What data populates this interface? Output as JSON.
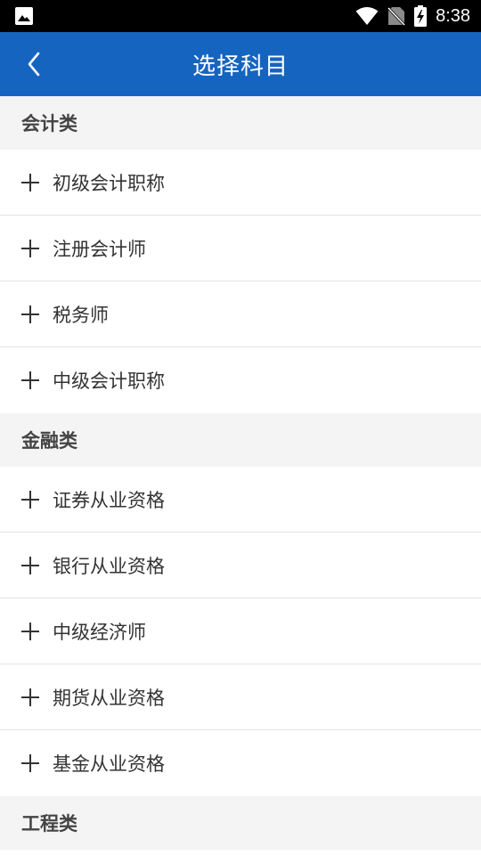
{
  "status_bar": {
    "time": "8:38",
    "icons": [
      "image-notification-icon",
      "wifi-icon",
      "no-sim-icon",
      "battery-charging-icon"
    ]
  },
  "app_bar": {
    "title": "选择科目",
    "back_icon": "chevron-left-icon",
    "color": "#1565c0"
  },
  "sections": [
    {
      "title": "会计类",
      "items": [
        "初级会计职称",
        "注册会计师",
        "税务师",
        "中级会计职称"
      ]
    },
    {
      "title": "金融类",
      "items": [
        "证券从业资格",
        "银行从业资格",
        "中级经济师",
        "期货从业资格",
        "基金从业资格"
      ]
    },
    {
      "title": "工程类",
      "items": []
    }
  ],
  "item_icon": "plus-icon"
}
